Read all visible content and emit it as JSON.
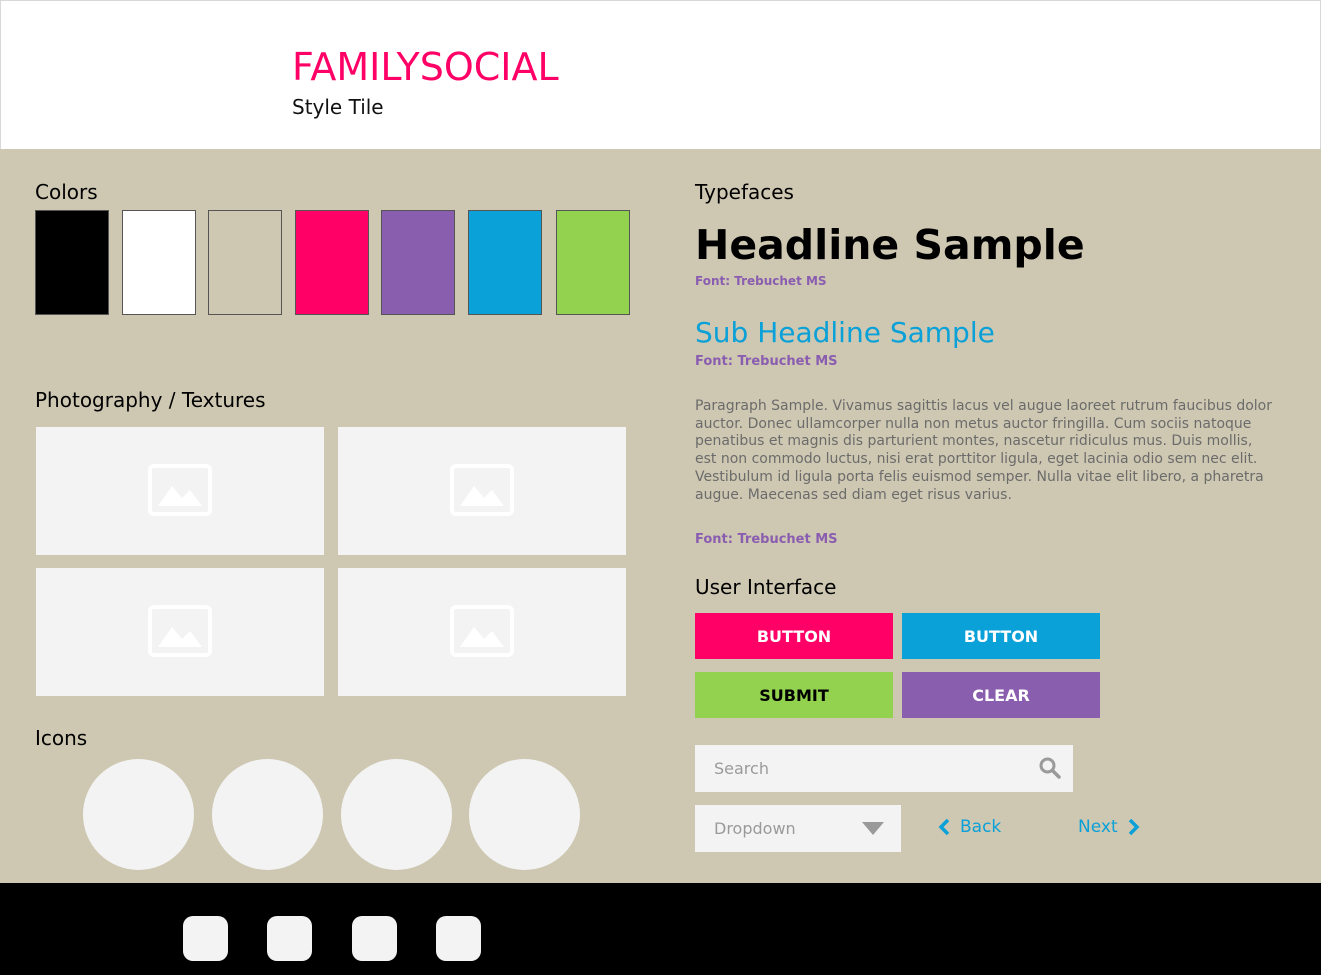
{
  "header": {
    "brand": "FAMILYSOCIAL",
    "subtitle": "Style Tile"
  },
  "colors": {
    "title": "Colors",
    "swatches": [
      "#000000",
      "#ffffff",
      "#cec8b2",
      "#ff0066",
      "#8a5eae",
      "#0aa0d8",
      "#92d24f"
    ]
  },
  "photography": {
    "title": "Photography / Textures",
    "placeholders": [
      "image-placeholder-icon",
      "image-placeholder-icon",
      "image-placeholder-icon",
      "image-placeholder-icon"
    ]
  },
  "icons": {
    "title": "Icons"
  },
  "typefaces": {
    "title": "Typefaces",
    "headline": "Headline Sample",
    "headline_font": "Font: Trebuchet MS",
    "subheadline": "Sub Headline Sample",
    "subheadline_font": "Font: Trebuchet MS",
    "paragraph": "Paragraph Sample. Vivamus sagittis lacus vel augue laoreet rutrum faucibus dolor auctor. Donec ullamcorper nulla non metus auctor fringilla. Cum sociis natoque penatibus et magnis dis parturient montes, nascetur ridiculus mus. Duis mollis, est non commodo luctus, nisi erat porttitor ligula, eget lacinia odio sem nec elit. Vestibulum id ligula porta felis euismod semper. Nulla vitae elit libero, a pharetra augue. Maecenas sed diam eget risus varius.",
    "paragraph_font": "Font: Trebuchet MS"
  },
  "ui": {
    "title": "User Interface",
    "button_pink": "BUTTON",
    "button_blue": "BUTTON",
    "submit": "SUBMIT",
    "clear": "CLEAR",
    "search_placeholder": "Search",
    "search_icon": "search-icon",
    "dropdown": "Dropdown",
    "back": "Back",
    "next": "Next"
  },
  "palette": {
    "pink": "#ff0066",
    "blue": "#0aa0d8",
    "green": "#92d24f",
    "purple": "#8a5eae",
    "tan": "#cec8b2"
  }
}
